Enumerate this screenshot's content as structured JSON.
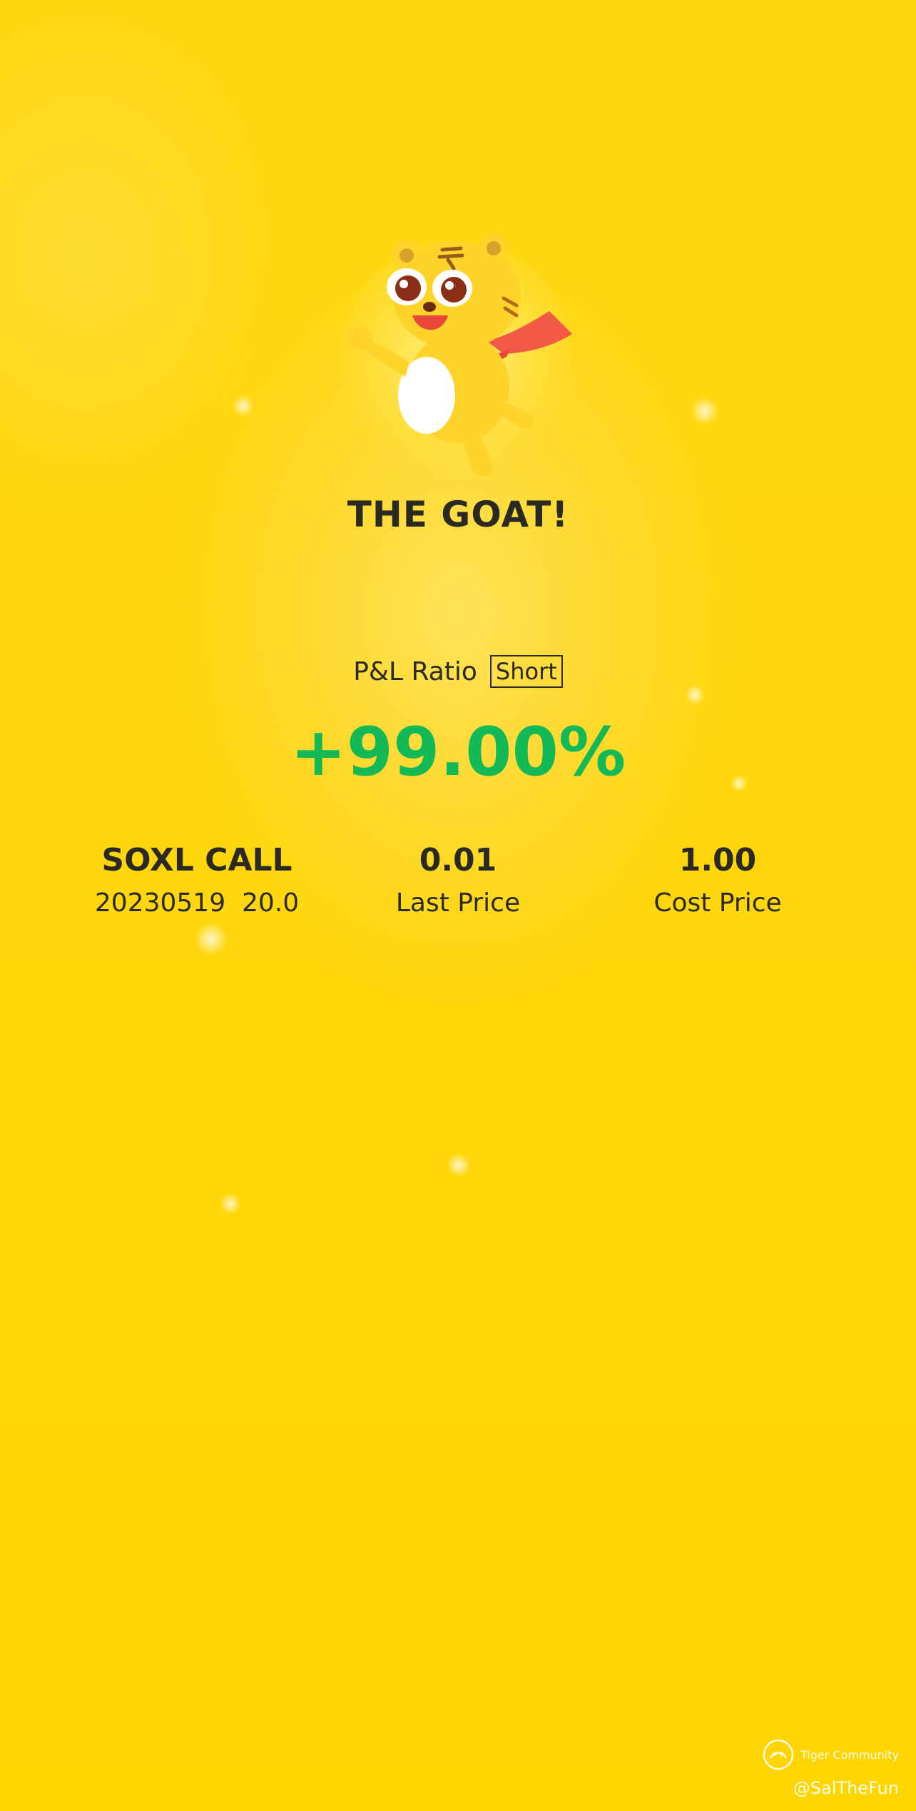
{
  "header": {
    "title": "THE GOAT!",
    "mascot_icon": "tiger-mascot-icon"
  },
  "pnl": {
    "label": "P&L Ratio",
    "badge": "Short",
    "value": "+99.00%",
    "value_color": "#12b956"
  },
  "stats": [
    {
      "value": "SOXL CALL",
      "label": "20230519  20.0"
    },
    {
      "value": "0.01",
      "label": "Last Price"
    },
    {
      "value": "1.00",
      "label": "Cost Price"
    }
  ],
  "watermark": {
    "brand": "Tiger Community",
    "handle": "@SalTheFun",
    "icon": "tiger-community-logo-icon"
  },
  "colors": {
    "background": "#ffd60a",
    "text": "#2b2a22",
    "gain": "#12b956"
  }
}
